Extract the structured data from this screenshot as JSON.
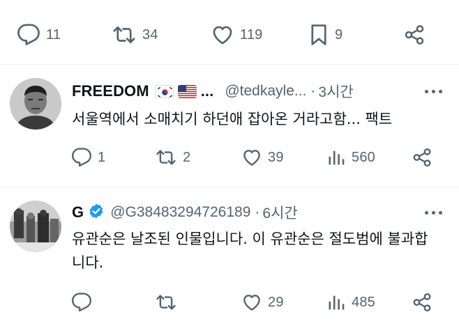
{
  "top_actions": {
    "reply_count": "11",
    "retweet_count": "34",
    "like_count": "119",
    "bookmark_count": "9"
  },
  "tweets": [
    {
      "display_name": "FREEDOM",
      "flags": [
        "south-korea",
        "usa"
      ],
      "name_ellipsis": "...",
      "handle": "@tedkayle...",
      "separator": "·",
      "time": "3시간",
      "text": "서울역에서 소매치기 하던애 잡아온 거라고함... 팩트",
      "reply_count": "1",
      "retweet_count": "2",
      "like_count": "39",
      "view_count": "560"
    },
    {
      "display_name": "G",
      "verified": true,
      "handle": "@G38483294726189",
      "separator": "·",
      "time": "6시간",
      "text": "유관순은 날조된 인물입니다. 이 유관순은 절도범에 불과합니다.",
      "reply_count": "",
      "retweet_count": "",
      "like_count": "29",
      "view_count": "485"
    }
  ],
  "colors": {
    "icon": "#536471",
    "text": "#0f1419",
    "verified": "#1d9bf0",
    "divider": "#eff3f4"
  }
}
